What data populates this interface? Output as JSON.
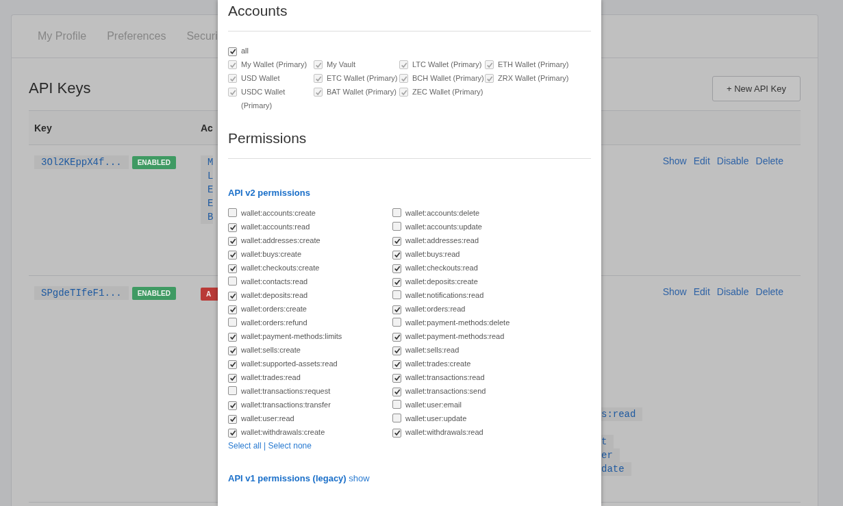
{
  "background_page": {
    "tabs": [
      "My Profile",
      "Preferences",
      "Securi"
    ],
    "title": "API Keys",
    "new_key_button": "+ New API Key",
    "columns": [
      "Key",
      "Ac"
    ],
    "rows": [
      {
        "key": "3Ol2KEppX4f...",
        "status": {
          "text": "ENABLED",
          "color": "#3f9a63"
        },
        "cell_2_start": {
          "kind": "chip",
          "lines": [
            "M",
            "L",
            "E",
            "E",
            "B"
          ]
        },
        "actions": [
          "Show",
          "Edit",
          "Disable",
          "Delete"
        ]
      },
      {
        "key": "SPgdeTIfeF1...",
        "status": {
          "text": "ENABLED",
          "color": "#3f9a63"
        },
        "cell_2_start": {
          "kind": "badge",
          "text": "A",
          "color": "#b93a37"
        },
        "actions": [
          "Show",
          "Edit",
          "Disable",
          "Delete"
        ],
        "cell_2_end": [
          [
            "s:read"
          ],
          [
            "t",
            "er",
            "date"
          ]
        ]
      }
    ]
  },
  "modal": {
    "accounts_heading": "Accounts",
    "all": {
      "label": "all",
      "checked": true,
      "disabled": false
    },
    "accounts": [
      {
        "label": "My Wallet (Primary)",
        "checked": true,
        "disabled": true
      },
      {
        "label": "My Vault",
        "checked": true,
        "disabled": true
      },
      {
        "label": "LTC Wallet (Primary)",
        "checked": true,
        "disabled": true
      },
      {
        "label": "ETH Wallet (Primary)",
        "checked": true,
        "disabled": true
      },
      {
        "label": "USD Wallet",
        "checked": true,
        "disabled": true
      },
      {
        "label": "ETC Wallet (Primary)",
        "checked": true,
        "disabled": true
      },
      {
        "label": "BCH Wallet (Primary)",
        "checked": true,
        "disabled": true
      },
      {
        "label": "ZRX Wallet (Primary)",
        "checked": true,
        "disabled": true
      },
      {
        "label": "USDC Wallet (Primary)",
        "checked": true,
        "disabled": true
      },
      {
        "label": "BAT Wallet (Primary)",
        "checked": true,
        "disabled": true
      },
      {
        "label": "ZEC Wallet (Primary)",
        "checked": true,
        "disabled": true
      }
    ],
    "permissions_heading": "Permissions",
    "v2_heading": "API v2 permissions",
    "permissions": [
      {
        "label": "wallet:accounts:create",
        "checked": false
      },
      {
        "label": "wallet:accounts:delete",
        "checked": false
      },
      {
        "label": "wallet:accounts:read",
        "checked": true
      },
      {
        "label": "wallet:accounts:update",
        "checked": false
      },
      {
        "label": "wallet:addresses:create",
        "checked": true
      },
      {
        "label": "wallet:addresses:read",
        "checked": true
      },
      {
        "label": "wallet:buys:create",
        "checked": true
      },
      {
        "label": "wallet:buys:read",
        "checked": true
      },
      {
        "label": "wallet:checkouts:create",
        "checked": true
      },
      {
        "label": "wallet:checkouts:read",
        "checked": true
      },
      {
        "label": "wallet:contacts:read",
        "checked": false
      },
      {
        "label": "wallet:deposits:create",
        "checked": true
      },
      {
        "label": "wallet:deposits:read",
        "checked": true
      },
      {
        "label": "wallet:notifications:read",
        "checked": false
      },
      {
        "label": "wallet:orders:create",
        "checked": true
      },
      {
        "label": "wallet:orders:read",
        "checked": true
      },
      {
        "label": "wallet:orders:refund",
        "checked": false
      },
      {
        "label": "wallet:payment-methods:delete",
        "checked": false
      },
      {
        "label": "wallet:payment-methods:limits",
        "checked": true
      },
      {
        "label": "wallet:payment-methods:read",
        "checked": true
      },
      {
        "label": "wallet:sells:create",
        "checked": true
      },
      {
        "label": "wallet:sells:read",
        "checked": true
      },
      {
        "label": "wallet:supported-assets:read",
        "checked": true
      },
      {
        "label": "wallet:trades:create",
        "checked": true
      },
      {
        "label": "wallet:trades:read",
        "checked": true
      },
      {
        "label": "wallet:transactions:read",
        "checked": true
      },
      {
        "label": "wallet:transactions:request",
        "checked": false
      },
      {
        "label": "wallet:transactions:send",
        "checked": true
      },
      {
        "label": "wallet:transactions:transfer",
        "checked": true
      },
      {
        "label": "wallet:user:email",
        "checked": false
      },
      {
        "label": "wallet:user:read",
        "checked": true
      },
      {
        "label": "wallet:user:update",
        "checked": false
      },
      {
        "label": "wallet:withdrawals:create",
        "checked": true
      },
      {
        "label": "wallet:withdrawals:read",
        "checked": true
      }
    ],
    "select_all": "Select all",
    "separator": "|",
    "select_none": "Select none",
    "v1_heading": "API v1 permissions (legacy)",
    "v1_toggle": "show"
  }
}
